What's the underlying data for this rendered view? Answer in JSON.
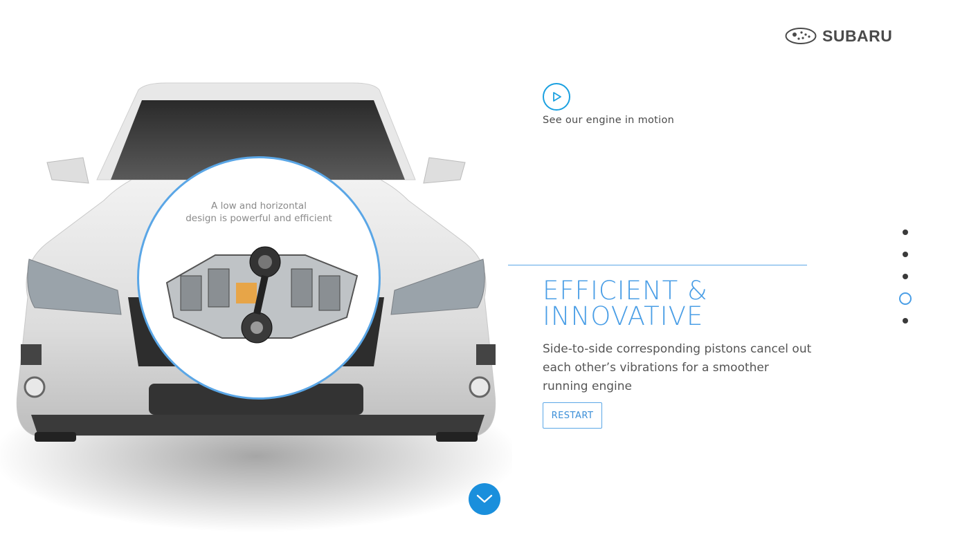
{
  "brand": {
    "name": "SUBARU",
    "logo_icon": "subaru-stars-oval-icon"
  },
  "hero": {
    "engine_caption_line1": "A low and horizontal",
    "engine_caption_line2": "design is powerful and efficient"
  },
  "video": {
    "icon": "play-icon",
    "label": "See our engine in motion"
  },
  "feature": {
    "title_line1": "EFFICIENT &",
    "title_line2": "INNOVATIVE",
    "description": "Side-to-side corresponding pistons cancel out each other’s vibrations for a smoother running engine",
    "restart_label": "RESTART"
  },
  "pagination": {
    "total": 5,
    "active_index": 3
  },
  "scroll": {
    "icon": "chevron-down-icon"
  },
  "colors": {
    "accent": "#4a9ee6",
    "button_blue": "#1a8fdc",
    "text": "#555555"
  }
}
